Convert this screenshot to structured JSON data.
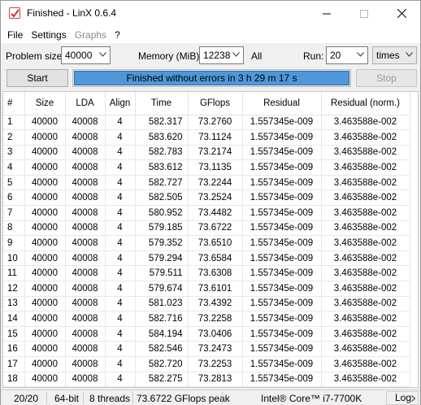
{
  "window": {
    "title": "Finished - LinX 0.6.4"
  },
  "menu": [
    "File",
    "Settings",
    "Graphs",
    "?"
  ],
  "settings": {
    "problem_size_label": "Problem size:",
    "problem_size_value": "40000",
    "memory_label": "Memory (MiB):",
    "memory_value": "12238",
    "memory_all": "All",
    "run_label": "Run:",
    "run_value": "20",
    "run_unit": "times"
  },
  "actions": {
    "start_label": "Start",
    "stop_label": "Stop",
    "status_text": "Finished without errors in 3 h 29 m 17 s",
    "progress": 1.0
  },
  "table": {
    "columns": [
      "#",
      "Size",
      "LDA",
      "Align",
      "Time",
      "GFlops",
      "Residual",
      "Residual (norm.)"
    ],
    "rows": [
      [
        "1",
        "40000",
        "40008",
        "4",
        "582.317",
        "73.2760",
        "1.557345e-009",
        "3.463588e-002"
      ],
      [
        "2",
        "40000",
        "40008",
        "4",
        "583.620",
        "73.1124",
        "1.557345e-009",
        "3.463588e-002"
      ],
      [
        "3",
        "40000",
        "40008",
        "4",
        "582.783",
        "73.2174",
        "1.557345e-009",
        "3.463588e-002"
      ],
      [
        "4",
        "40000",
        "40008",
        "4",
        "583.612",
        "73.1135",
        "1.557345e-009",
        "3.463588e-002"
      ],
      [
        "5",
        "40000",
        "40008",
        "4",
        "582.727",
        "73.2244",
        "1.557345e-009",
        "3.463588e-002"
      ],
      [
        "6",
        "40000",
        "40008",
        "4",
        "582.505",
        "73.2524",
        "1.557345e-009",
        "3.463588e-002"
      ],
      [
        "7",
        "40000",
        "40008",
        "4",
        "580.952",
        "73.4482",
        "1.557345e-009",
        "3.463588e-002"
      ],
      [
        "8",
        "40000",
        "40008",
        "4",
        "579.185",
        "73.6722",
        "1.557345e-009",
        "3.463588e-002"
      ],
      [
        "9",
        "40000",
        "40008",
        "4",
        "579.352",
        "73.6510",
        "1.557345e-009",
        "3.463588e-002"
      ],
      [
        "10",
        "40000",
        "40008",
        "4",
        "579.294",
        "73.6584",
        "1.557345e-009",
        "3.463588e-002"
      ],
      [
        "11",
        "40000",
        "40008",
        "4",
        "579.511",
        "73.6308",
        "1.557345e-009",
        "3.463588e-002"
      ],
      [
        "12",
        "40000",
        "40008",
        "4",
        "579.674",
        "73.6101",
        "1.557345e-009",
        "3.463588e-002"
      ],
      [
        "13",
        "40000",
        "40008",
        "4",
        "581.023",
        "73.4392",
        "1.557345e-009",
        "3.463588e-002"
      ],
      [
        "14",
        "40000",
        "40008",
        "4",
        "582.716",
        "73.2258",
        "1.557345e-009",
        "3.463588e-002"
      ],
      [
        "15",
        "40000",
        "40008",
        "4",
        "584.194",
        "73.0406",
        "1.557345e-009",
        "3.463588e-002"
      ],
      [
        "16",
        "40000",
        "40008",
        "4",
        "582.546",
        "73.2473",
        "1.557345e-009",
        "3.463588e-002"
      ],
      [
        "17",
        "40000",
        "40008",
        "4",
        "582.720",
        "73.2253",
        "1.557345e-009",
        "3.463588e-002"
      ],
      [
        "18",
        "40000",
        "40008",
        "4",
        "582.275",
        "73.2813",
        "1.557345e-009",
        "3.463588e-002"
      ],
      [
        "19",
        "40000",
        "40008",
        "4",
        "581.133",
        "73.4253",
        "1.557345e-009",
        "3.463588e-002"
      ],
      [
        "20",
        "40000",
        "40008",
        "4",
        "580.785",
        "73.4693",
        "1.557345e-009",
        "3.463588e-002"
      ]
    ],
    "selected_row": 19
  },
  "status": {
    "runs": "20/20",
    "bits": "64-bit",
    "threads": "8 threads",
    "peak": "73.6722 GFlops peak",
    "cpu": "Intel® Core™ i7-7700K",
    "log_label": "Log"
  },
  "colors": {
    "progress_fill": "#4f97d8",
    "selection": "#cce8ff"
  }
}
